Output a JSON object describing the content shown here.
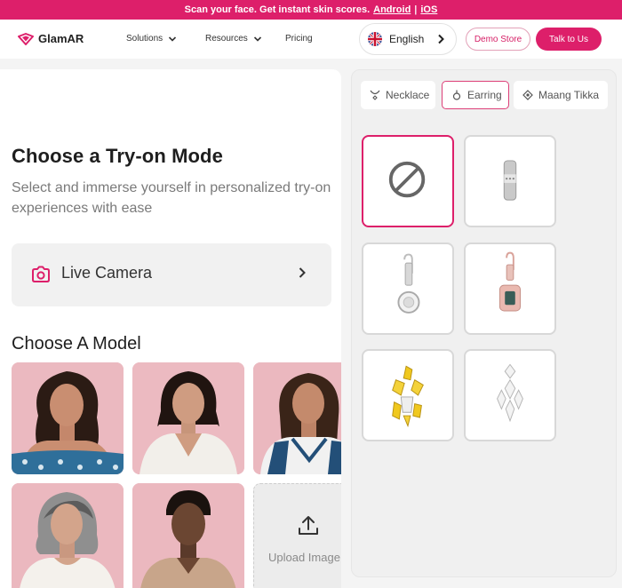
{
  "banner": {
    "text": "Scan your face. Get instant skin scores.",
    "android": "Android",
    "separator": "|",
    "ios": "iOS"
  },
  "nav": {
    "logo": "GlamAR",
    "solutions": "Solutions",
    "resources": "Resources",
    "pricing": "Pricing",
    "language": "English",
    "demo_store": "Demo Store",
    "talk_to_us": "Talk to Us"
  },
  "tryon": {
    "title": "Choose a Try-on Mode",
    "subtitle": "Select and immerse yourself in personalized try-on experiences with ease",
    "live_camera": "Live Camera",
    "models_title": "Choose A Model",
    "upload_label": "Upload Image"
  },
  "models": [
    "model-1",
    "model-2",
    "model-3",
    "model-4",
    "model-5"
  ],
  "categories": {
    "tabs": [
      {
        "label": "Necklace",
        "icon": "necklace-icon"
      },
      {
        "label": "Earring",
        "icon": "earring-icon",
        "active": true
      },
      {
        "label": "Maang Tikka",
        "icon": "maang-tikka-icon"
      }
    ]
  },
  "earrings": [
    "none",
    "silver-hoop",
    "solitaire-drop",
    "emerald-cut-drop",
    "yellow-cluster",
    "crystal-chandelier"
  ],
  "colors": {
    "brand": "#dd1f6a",
    "selected_border": "#dd1f6a",
    "panel_bg": "#f0f0f0"
  }
}
